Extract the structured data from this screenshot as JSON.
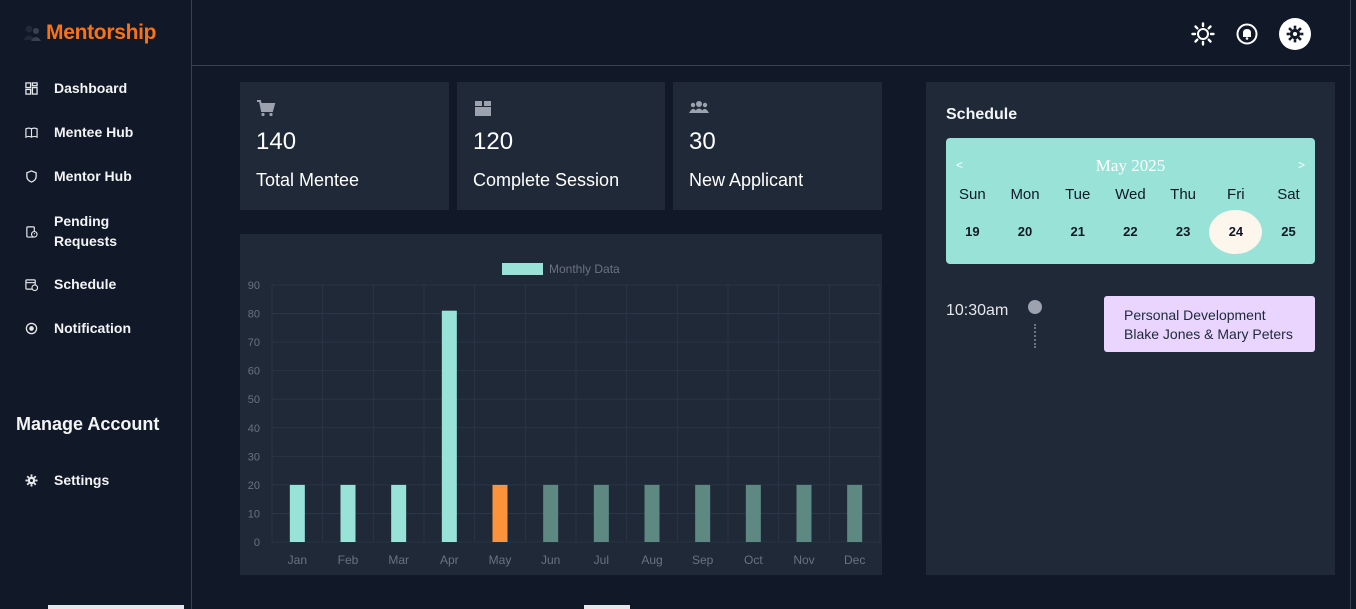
{
  "brand": {
    "name": "Mentorship",
    "logo_icon": "mentorship-logo-icon"
  },
  "sidebar": {
    "items": [
      {
        "label": "Dashboard",
        "icon": "dashboard-icon"
      },
      {
        "label": "Mentee Hub",
        "icon": "book-icon"
      },
      {
        "label": "Mentor Hub",
        "icon": "shield-icon"
      },
      {
        "label": "Pending Requests",
        "icon": "pending-icon"
      },
      {
        "label": "Schedule",
        "icon": "calendar-clock-icon"
      },
      {
        "label": "Notification",
        "icon": "notification-icon"
      }
    ],
    "section_title": "Manage Account",
    "settings": {
      "label": "Settings",
      "icon": "gear-icon"
    }
  },
  "topbar": {
    "icons": [
      "sun-icon",
      "bell-icon",
      "gear-icon"
    ]
  },
  "stats": [
    {
      "value": "140",
      "label": "Total Mentee",
      "icon": "cart-icon"
    },
    {
      "value": "120",
      "label": "Complete Session",
      "icon": "box-icon"
    },
    {
      "value": "30",
      "label": "New Applicant",
      "icon": "users-icon"
    }
  ],
  "chart_data": {
    "type": "bar",
    "legend": "Monthly Data",
    "legend_position": "top",
    "categories": [
      "Jan",
      "Feb",
      "Mar",
      "Apr",
      "May",
      "Jun",
      "Jul",
      "Aug",
      "Sep",
      "Oct",
      "Nov",
      "Dec"
    ],
    "values": [
      20,
      20,
      20,
      81,
      20,
      20,
      20,
      20,
      20,
      20,
      20,
      20
    ],
    "y_ticks": [
      "90",
      "80",
      "70",
      "60",
      "50",
      "40",
      "30",
      "20",
      "10",
      "0"
    ],
    "ylim": [
      0,
      90
    ],
    "grid": true,
    "colors": {
      "default": "#99e2d7",
      "highlight": "#fb923c",
      "faded": "#5e8983",
      "background": "#1f2937",
      "grid": "#2a3545"
    },
    "highlight_category": "May",
    "faded_from_index": 5
  },
  "schedule": {
    "title": "Schedule",
    "calendar": {
      "prev": "<",
      "next": ">",
      "title": "May 2025",
      "weekdays": [
        "Sun",
        "Mon",
        "Tue",
        "Wed",
        "Thu",
        "Fri",
        "Sat"
      ],
      "days": [
        "19",
        "20",
        "21",
        "22",
        "23",
        "24",
        "25"
      ],
      "selected": "24"
    },
    "event": {
      "time": "10:30am",
      "title": "Personal Development",
      "people": "Blake Jones & Mary Peters"
    }
  },
  "colors": {
    "background": "#111827",
    "panel": "#1f2937",
    "brand": "#f97316",
    "calendar": "#99e2d7",
    "event": "#e9d5ff"
  }
}
